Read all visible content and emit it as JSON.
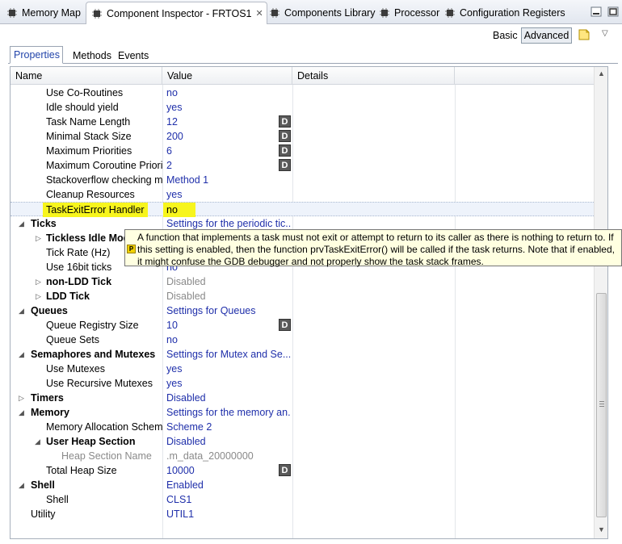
{
  "view_tabs": [
    {
      "label": "Memory Map"
    },
    {
      "label": "Component Inspector - FRTOS1"
    },
    {
      "label": "Components Library"
    },
    {
      "label": "Processor"
    },
    {
      "label": "Configuration Registers"
    }
  ],
  "toolbar": {
    "basic": "Basic",
    "advanced": "Advanced"
  },
  "sub_tabs": [
    {
      "label": "Properties"
    },
    {
      "label": "Methods"
    },
    {
      "label": "Events"
    }
  ],
  "columns": {
    "name": "Name",
    "value": "Value",
    "details": "Details"
  },
  "rows": [
    {
      "name": "Use Co-Routines",
      "value": "no"
    },
    {
      "name": "Idle should yield",
      "value": "yes"
    },
    {
      "name": "Task Name Length",
      "value": "12",
      "dbtn": "D"
    },
    {
      "name": "Minimal Stack Size",
      "value": "200",
      "dbtn": "D"
    },
    {
      "name": "Maximum Priorities",
      "value": "6",
      "dbtn": "D"
    },
    {
      "name": "Maximum Coroutine Priorit",
      "value": "2",
      "dbtn": "D"
    },
    {
      "name": "Stackoverflow checking me",
      "value": "Method 1"
    },
    {
      "name": "Cleanup Resources",
      "value": "yes"
    },
    {
      "name": "TaskExitError Handler",
      "value": "no"
    },
    {
      "name": "Ticks",
      "value": "Settings for the periodic tic..."
    },
    {
      "name": "Tickless Idle Mode",
      "value": ""
    },
    {
      "name": "Tick Rate (Hz)",
      "value": ""
    },
    {
      "name": "Use 16bit ticks",
      "value": "no"
    },
    {
      "name": "non-LDD Tick",
      "value": "Disabled"
    },
    {
      "name": "LDD Tick",
      "value": "Disabled"
    },
    {
      "name": "Queues",
      "value": "Settings for Queues"
    },
    {
      "name": "Queue Registry Size",
      "value": "10",
      "dbtn": "D"
    },
    {
      "name": "Queue Sets",
      "value": "no"
    },
    {
      "name": "Semaphores and Mutexes",
      "value": "Settings for Mutex and Se..."
    },
    {
      "name": "Use Mutexes",
      "value": "yes"
    },
    {
      "name": "Use Recursive Mutexes",
      "value": "yes"
    },
    {
      "name": "Timers",
      "value": "Disabled"
    },
    {
      "name": "Memory",
      "value": "Settings for the memory an..."
    },
    {
      "name": "Memory Allocation Scheme",
      "value": "Scheme 2"
    },
    {
      "name": "User Heap Section",
      "value": "Disabled"
    },
    {
      "name": "Heap Section Name",
      "value": ".m_data_20000000"
    },
    {
      "name": "Total Heap Size",
      "value": "10000",
      "dbtn": "D"
    },
    {
      "name": "Shell",
      "value": "Enabled"
    },
    {
      "name": "Shell",
      "value": "CLS1"
    },
    {
      "name": "Utility",
      "value": "UTIL1"
    }
  ],
  "tooltip": {
    "icon": "P",
    "text": "A function that implements a task must not exit or attempt to return to its caller as there is nothing to return to. If this setting is enabled, then the function prvTaskExitError() will be called if the task returns. Note that if enabled, it might confuse the GDB debugger and not properly show the task stack frames."
  },
  "colors": {
    "value_text": "#1f2faa",
    "highlight": "#f7f51d",
    "disabled": "#8a8a8a",
    "tooltip_bg": "#ffffe1"
  }
}
